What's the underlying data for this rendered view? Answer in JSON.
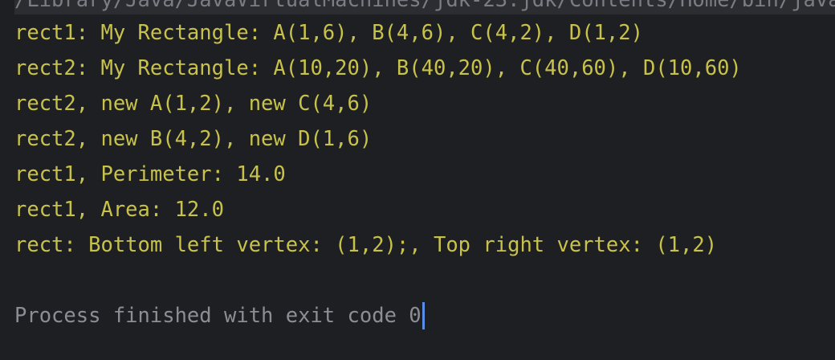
{
  "console": {
    "command_line": "/Library/Java/JavaVirtualMachines/jdk-23.jdk/Contents/Home/bin/java",
    "output": [
      "rect1: My Rectangle: A(1,6), B(4,6), C(4,2), D(1,2)",
      "rect2: My Rectangle: A(10,20), B(40,20), C(40,60), D(10,60)",
      "rect2, new A(1,2), new C(4,6)",
      "rect2, new B(4,2), new D(1,6)",
      "rect1, Perimeter: 14.0",
      "rect1, Area: 12.0",
      "rect: Bottom left vertex: (1,2);, Top right vertex: (1,2)"
    ],
    "process_message": "Process finished with exit code 0"
  },
  "colors": {
    "background": "#1e1f22",
    "output_text": "#c8c24b",
    "process_text": "#8c8e94",
    "caret": "#5a8ee6"
  }
}
